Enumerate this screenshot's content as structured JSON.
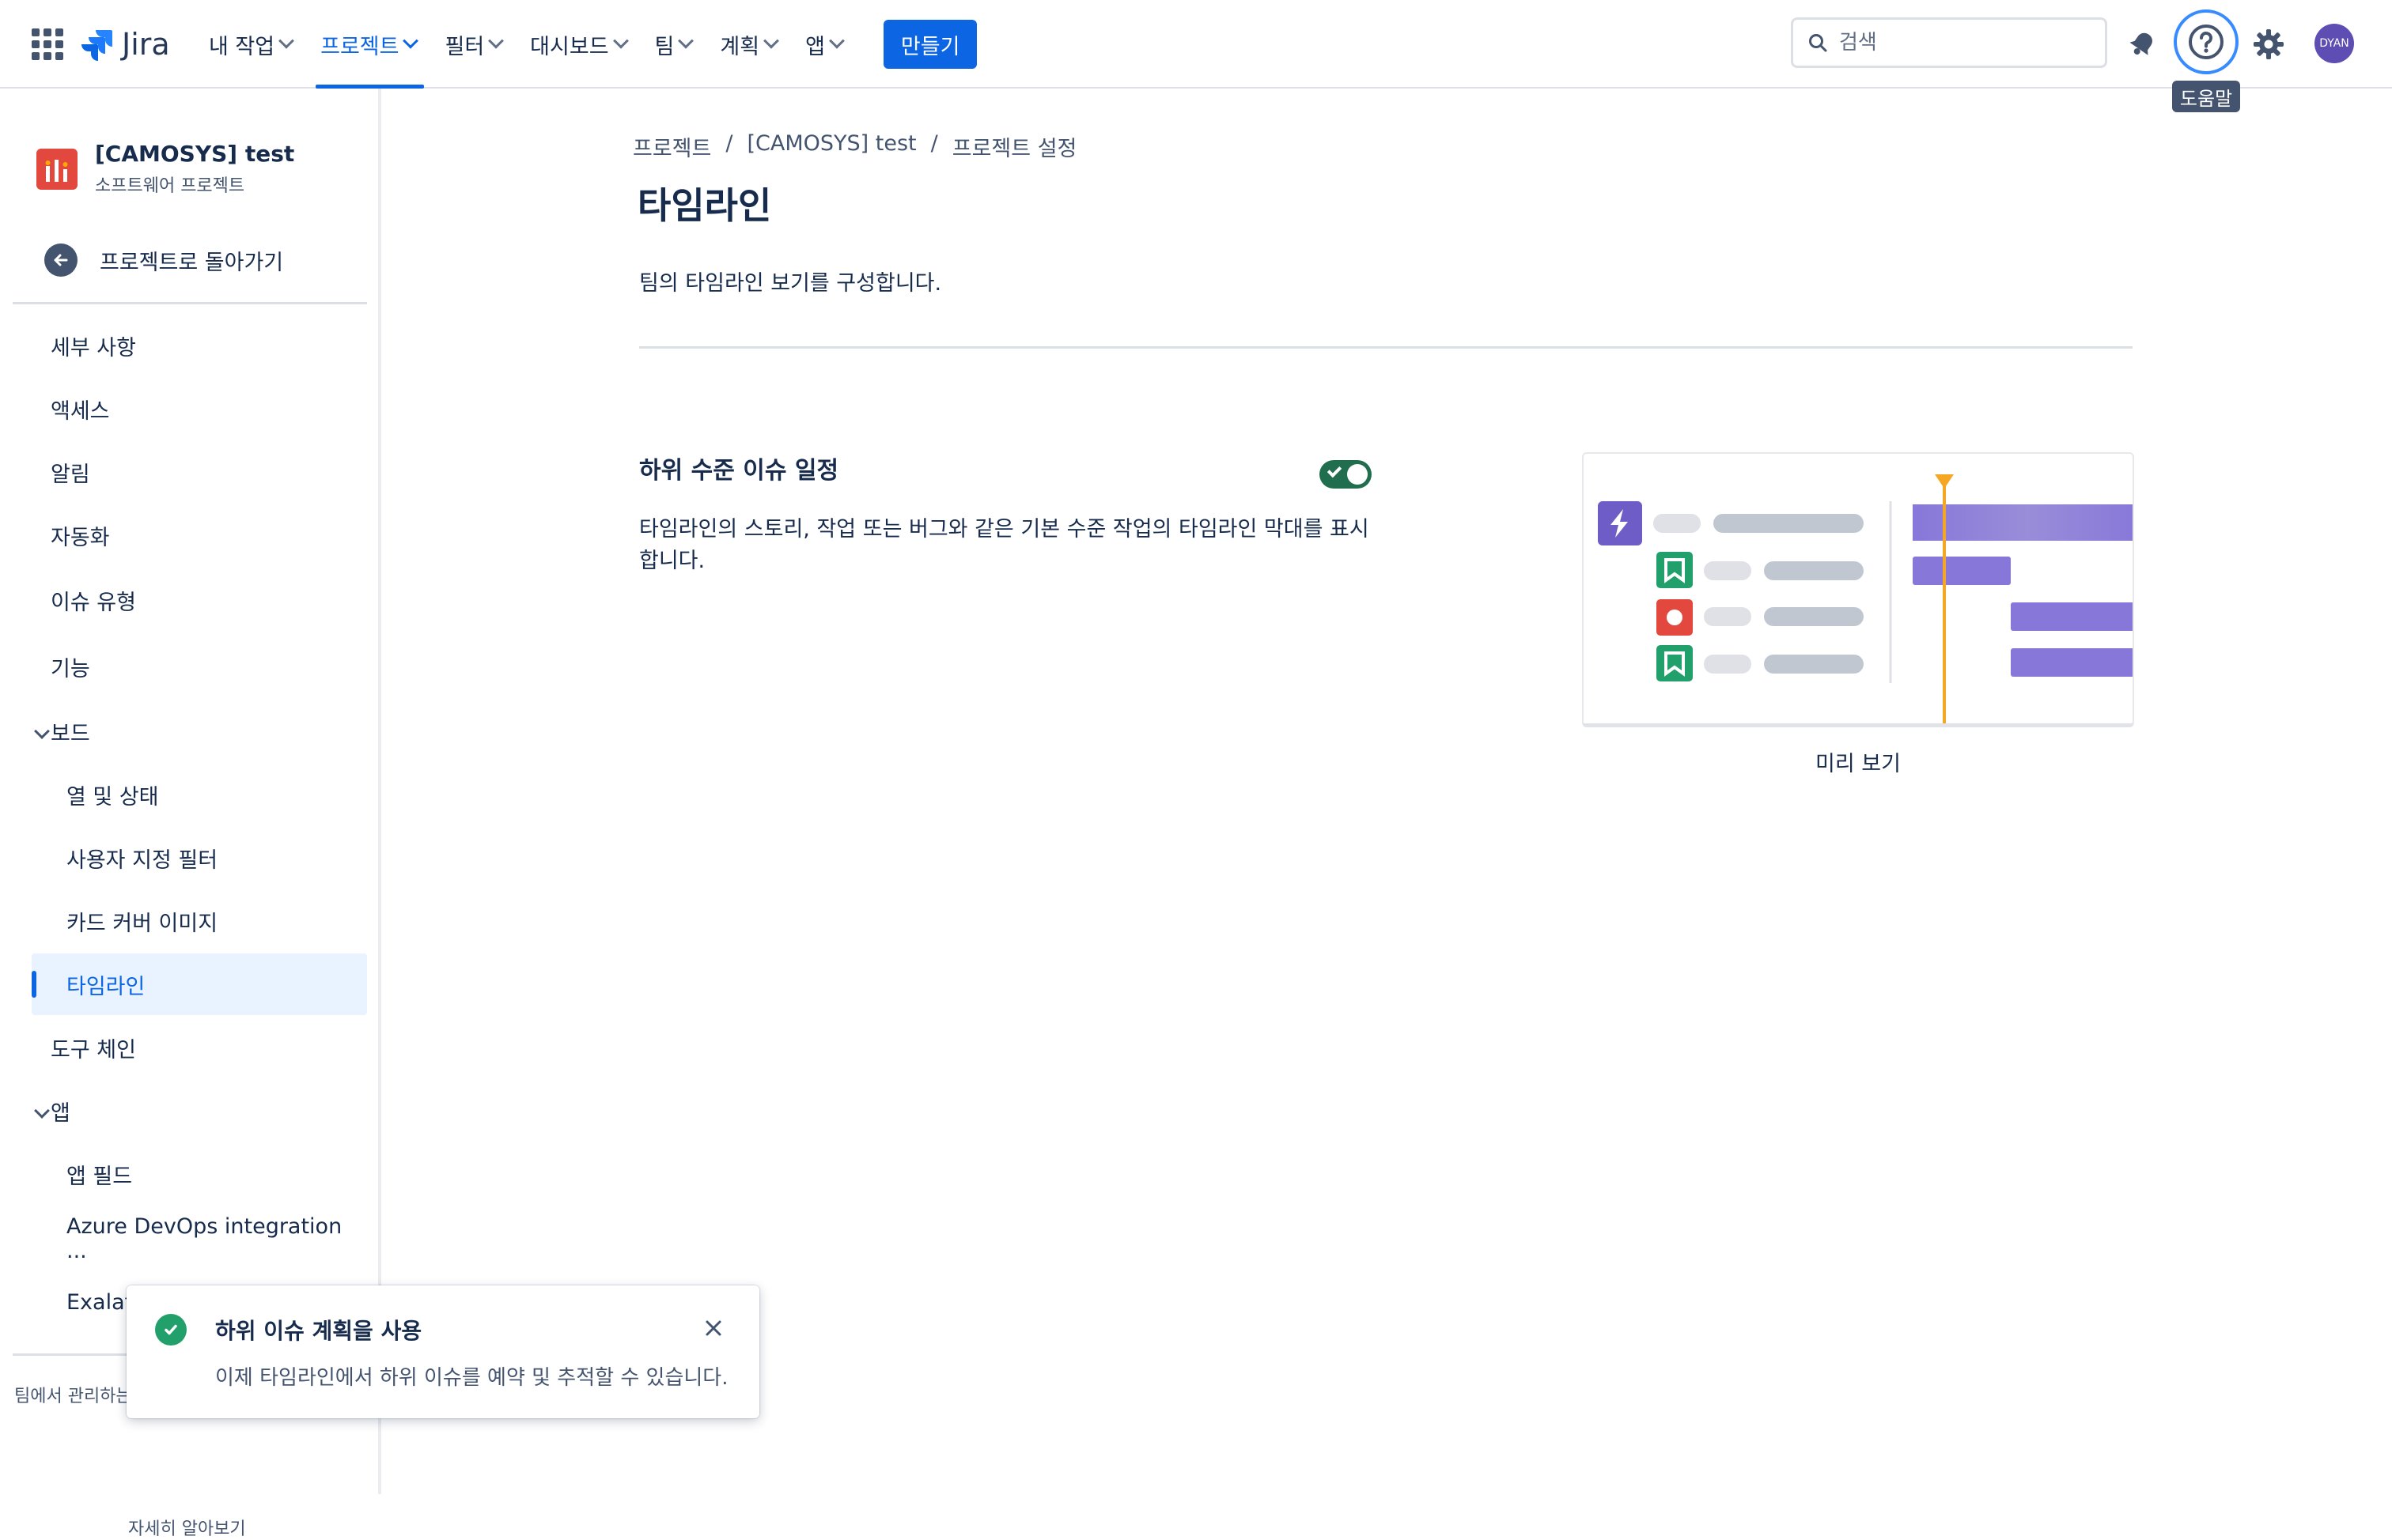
{
  "topbar": {
    "logo_text": "Jira",
    "nav": [
      {
        "label": "내 작업",
        "active": false
      },
      {
        "label": "프로젝트",
        "active": true
      },
      {
        "label": "필터",
        "active": false
      },
      {
        "label": "대시보드",
        "active": false
      },
      {
        "label": "팀",
        "active": false
      },
      {
        "label": "계획",
        "active": false
      },
      {
        "label": "앱",
        "active": false
      }
    ],
    "create_label": "만들기",
    "search_placeholder": "검색",
    "help_tooltip": "도움말",
    "avatar_initials": "DYAN",
    "accent_color": "#0c66e4"
  },
  "sidebar": {
    "project_name": "[CAMOSYS] test",
    "project_type": "소프트웨어 프로젝트",
    "back_label": "프로젝트로 돌아가기",
    "items": [
      {
        "label": "세부 사항"
      },
      {
        "label": "액세스"
      },
      {
        "label": "알림"
      },
      {
        "label": "자동화"
      },
      {
        "label": "이슈 유형"
      },
      {
        "label": "기능"
      },
      {
        "label": "보드",
        "group": true
      },
      {
        "label": "열 및 상태"
      },
      {
        "label": "사용자 지정 필터"
      },
      {
        "label": "카드 커버 이미지"
      },
      {
        "label": "타임라인",
        "selected": true
      },
      {
        "label": "도구 체인"
      },
      {
        "label": "앱",
        "group": true
      },
      {
        "label": "앱 필드"
      },
      {
        "label": "Azure DevOps integration ..."
      },
      {
        "label": "Exalat"
      }
    ],
    "footer_text": "팀에서 관리하는",
    "learn_more": "자세히 알아보기"
  },
  "main": {
    "breadcrumb": [
      "프로젝트",
      "/",
      "[CAMOSYS] test",
      "/",
      "프로젝트 설정"
    ],
    "title": "타임라인",
    "description": "팀의 타임라인 보기를 구성합니다.",
    "section": {
      "title": "하위 수준 이슈 일정",
      "toggle_on": true,
      "description": "타임라인의 스토리, 작업 또는 버그와 같은 기본 수준 작업의 타임라인 막대를 표시합니다."
    },
    "preview_caption": "미리 보기"
  },
  "toast": {
    "title": "하위 이슈 계획을 사용",
    "body": "이제 타임라인에서 하위 이슈를 예약 및 추적할 수 있습니다."
  }
}
